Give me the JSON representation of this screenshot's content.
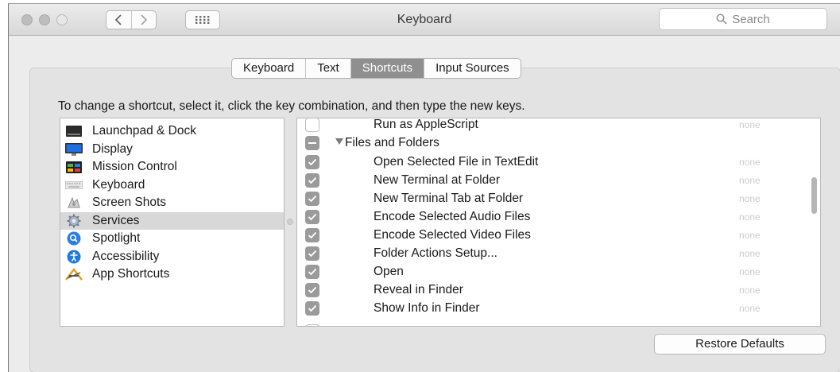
{
  "window": {
    "title": "Keyboard",
    "search_placeholder": "Search"
  },
  "tabs": [
    {
      "label": "Keyboard",
      "selected": false
    },
    {
      "label": "Text",
      "selected": false
    },
    {
      "label": "Shortcuts",
      "selected": true
    },
    {
      "label": "Input Sources",
      "selected": false
    }
  ],
  "instruction": "To change a shortcut, select it, click the key combination, and then type the new keys.",
  "categories": [
    {
      "label": "Launchpad & Dock",
      "icon": "launchpad-dock-icon"
    },
    {
      "label": "Display",
      "icon": "display-icon"
    },
    {
      "label": "Mission Control",
      "icon": "mission-control-icon"
    },
    {
      "label": "Keyboard",
      "icon": "keyboard-icon"
    },
    {
      "label": "Screen Shots",
      "icon": "screen-shots-icon"
    },
    {
      "label": "Services",
      "icon": "services-gear-icon",
      "selected": true
    },
    {
      "label": "Spotlight",
      "icon": "spotlight-icon"
    },
    {
      "label": "Accessibility",
      "icon": "accessibility-icon"
    },
    {
      "label": "App Shortcuts",
      "icon": "app-shortcuts-icon"
    }
  ],
  "shortcuts": [
    {
      "label": "Run as AppleScript",
      "key": "none",
      "checked": false,
      "partial": true
    },
    {
      "label": "Files and Folders",
      "group": true,
      "checked": "mixed"
    },
    {
      "label": "Open Selected File in TextEdit",
      "key": "none",
      "checked": true
    },
    {
      "label": "New Terminal at Folder",
      "key": "none",
      "checked": true
    },
    {
      "label": "New Terminal Tab at Folder",
      "key": "none",
      "checked": true
    },
    {
      "label": "Encode Selected Audio Files",
      "key": "none",
      "checked": true
    },
    {
      "label": "Encode Selected Video Files",
      "key": "none",
      "checked": true
    },
    {
      "label": "Folder Actions Setup...",
      "key": "none",
      "checked": true
    },
    {
      "label": "Open",
      "key": "none",
      "checked": true
    },
    {
      "label": "Reveal in Finder",
      "key": "none",
      "checked": true
    },
    {
      "label": "Show Info in Finder",
      "key": "none",
      "checked": true
    }
  ],
  "restore_label": "Restore Defaults",
  "colors": {
    "selected_tab": "#8f8f8f",
    "checkbox": "#9a9a9a",
    "selected_row": "#d8d8d8",
    "spotlight_blue": "#2b7de9",
    "accessibility_blue": "#1f7ae0"
  }
}
